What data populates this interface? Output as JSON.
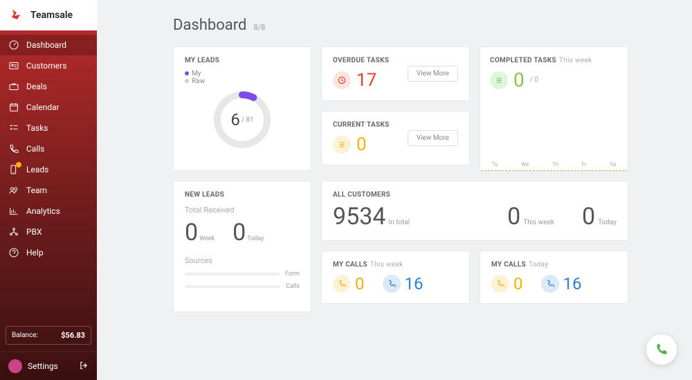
{
  "brand": "Teamsale",
  "page": {
    "title": "Dashboard",
    "counter": "8/8"
  },
  "nav": {
    "items": [
      {
        "label": "Dashboard",
        "active": true
      },
      {
        "label": "Customers"
      },
      {
        "label": "Deals"
      },
      {
        "label": "Calendar"
      },
      {
        "label": "Tasks"
      },
      {
        "label": "Calls"
      },
      {
        "label": "Leads",
        "badge": true
      },
      {
        "label": "Team"
      },
      {
        "label": "Analytics"
      },
      {
        "label": "PBX"
      },
      {
        "label": "Help"
      }
    ]
  },
  "balance": {
    "label": "Balance:",
    "amount": "$56.83"
  },
  "settings_label": "Settings",
  "myleads": {
    "title": "MY LEADS",
    "legend_my": "My",
    "legend_raw": "Raw",
    "value": "6",
    "total": "/ 81",
    "colors": {
      "my": "#7b4de8",
      "raw": "#cfcfcf"
    }
  },
  "overdue": {
    "title": "OVERDUE TASKS",
    "value": "17",
    "view_more": "View More",
    "color": "#e63e2b"
  },
  "current": {
    "title": "CURRENT TASKS",
    "value": "0",
    "view_more": "View More",
    "color": "#f2b300"
  },
  "completed": {
    "title": "COMPLETED TASKS",
    "sub": "This week",
    "value": "0",
    "total": "/ 0",
    "days": [
      "Tu",
      "We",
      "Th",
      "Fr",
      "Sa"
    ],
    "color": "#8bc34a"
  },
  "newleads": {
    "title": "NEW LEADS",
    "received_label": "Total Received",
    "week": {
      "value": "0",
      "label": "Week"
    },
    "today": {
      "value": "0",
      "label": "Today"
    },
    "sources_label": "Sources",
    "sources": [
      {
        "label": "Form"
      },
      {
        "label": "Calls"
      }
    ]
  },
  "customers": {
    "title": "ALL CUSTOMERS",
    "total": {
      "value": "9534",
      "label": "In total"
    },
    "week": {
      "value": "0",
      "label": "This week"
    },
    "today": {
      "value": "0",
      "label": "Today"
    }
  },
  "calls_week": {
    "title": "MY CALLS",
    "sub": "This week",
    "out": {
      "value": "0",
      "color": "#f2b300"
    },
    "in": {
      "value": "16",
      "color": "#2f7ed8"
    }
  },
  "calls_today": {
    "title": "MY CALLS",
    "sub": "Today",
    "out": {
      "value": "0",
      "color": "#f2b300"
    },
    "in": {
      "value": "16",
      "color": "#2f7ed8"
    }
  },
  "chart_data": {
    "type": "pie",
    "title": "My Leads",
    "series": [
      {
        "name": "My",
        "value": 6
      },
      {
        "name": "Raw",
        "value": 75
      }
    ],
    "total": 81
  }
}
